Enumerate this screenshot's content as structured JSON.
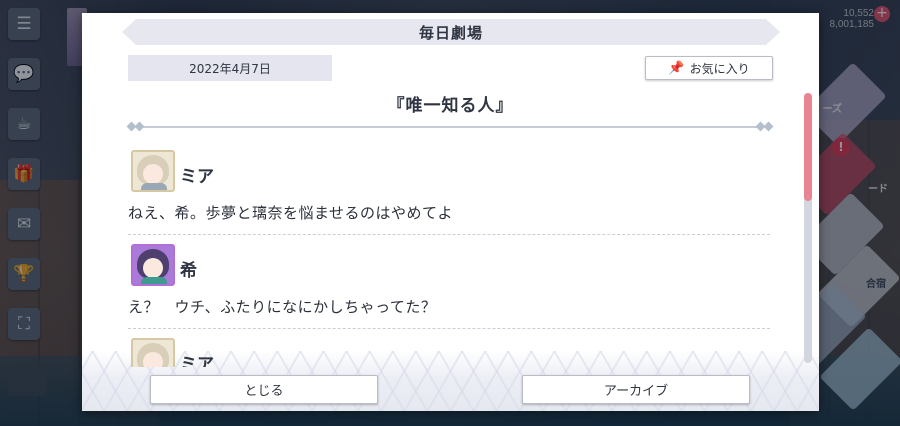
{
  "modal": {
    "title": "毎日劇場",
    "date": "2022年4月7日",
    "favorite_label": "お気に入り",
    "episode_title": "『唯一知る人』",
    "close_label": "とじる",
    "archive_label": "アーカイブ"
  },
  "dialogue": [
    {
      "speaker": "ミア",
      "text": "ねえ、希。歩夢と璃奈を悩ませるのはやめてよ",
      "avatar": "mia-avatar"
    },
    {
      "speaker": "希",
      "text": "え？　ウチ、ふたりになにかしちゃってた？",
      "avatar": "nozomi-avatar"
    },
    {
      "speaker": "ミア",
      "text": "",
      "avatar": "mia-avatar"
    }
  ],
  "scrollbar": {
    "position_fraction": 0.0,
    "visible_fraction": 0.4
  },
  "background": {
    "hud_count_top": "10,552",
    "hud_count_bottom": "8,001,185",
    "badge": "!",
    "card_label_1": "ーズ",
    "card_label_2": "ード",
    "card_label_3": "合宿"
  },
  "icons": {
    "menu": "☰",
    "chat": "💬",
    "cup": "☕",
    "gift": "🎁",
    "message": "✉",
    "trophy": "🏆",
    "expand": "⛶",
    "pin": "📌"
  },
  "colors": {
    "accent": "#e98593",
    "panel": "#ffffff",
    "title_bar": "#e7e8ef"
  }
}
